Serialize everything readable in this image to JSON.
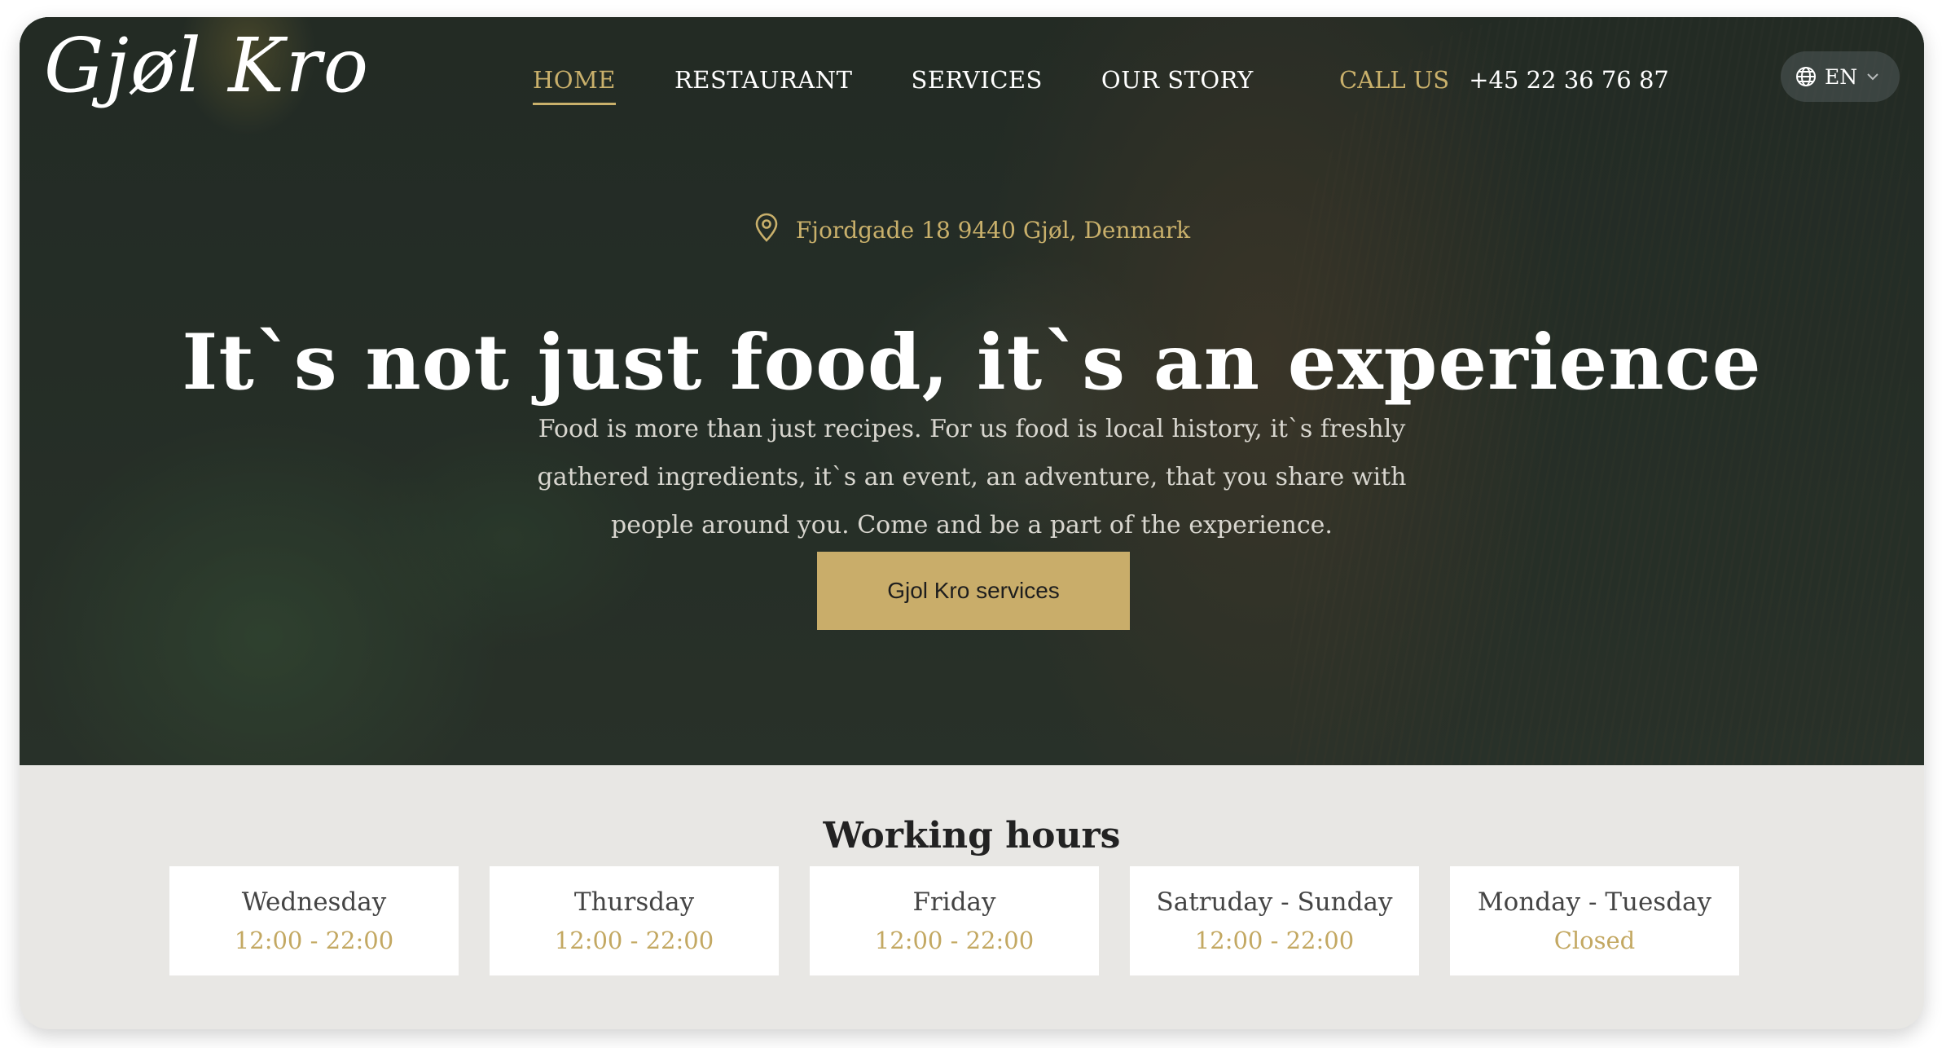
{
  "brand": {
    "logo_text": "Gjøl Kro",
    "accent_color": "#c9b06b"
  },
  "nav": {
    "items": [
      {
        "label": "HOME",
        "active": true
      },
      {
        "label": "RESTAURANT",
        "active": false
      },
      {
        "label": "SERVICES",
        "active": false
      },
      {
        "label": "OUR STORY",
        "active": false
      }
    ],
    "call_label": "CALL US",
    "phone": "+45 22 36 76 87",
    "language": "EN",
    "language_icon": "globe-icon",
    "language_chevron_icon": "chevron-down-icon"
  },
  "hero": {
    "location_icon": "map-pin-icon",
    "address": "Fjordgade 18 9440 Gjøl, Denmark",
    "headline": "It`s not just food, it`s an experience",
    "intro": "Food is more than just recipes. For us food is local history, it`s freshly gathered ingredients, it`s an event, an adventure, that you share with people around you. Come and be a part of the experience.",
    "cta_label": "Gjol Kro services"
  },
  "working_hours": {
    "title": "Working hours",
    "days": [
      {
        "day": "Wednesday",
        "time": "12:00 - 22:00"
      },
      {
        "day": "Thursday",
        "time": "12:00 - 22:00"
      },
      {
        "day": "Friday",
        "time": "12:00 - 22:00"
      },
      {
        "day": "Satruday - Sunday",
        "time": "12:00 - 22:00"
      },
      {
        "day": "Monday - Tuesday",
        "time": "Closed"
      }
    ]
  }
}
